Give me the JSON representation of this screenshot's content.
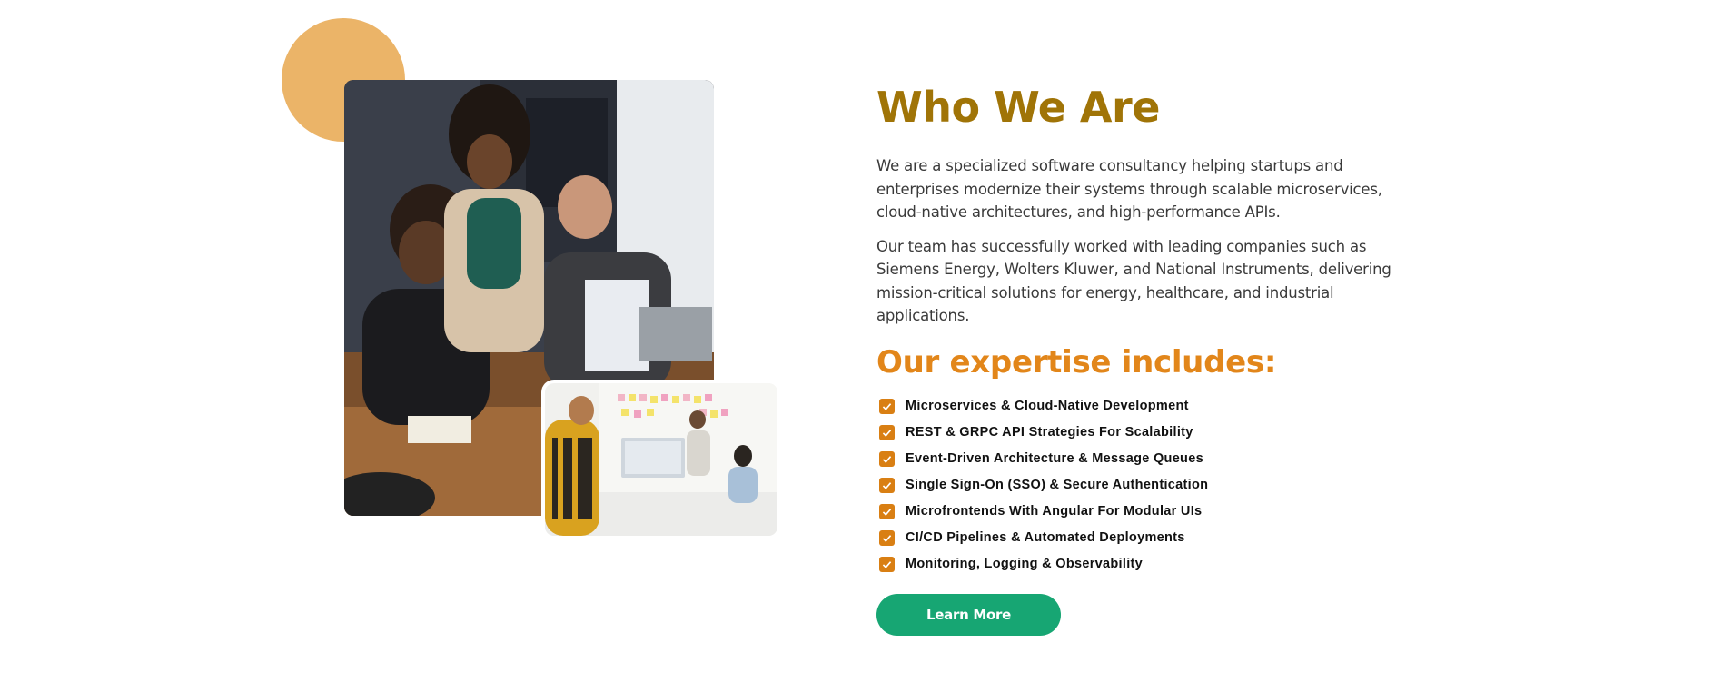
{
  "about": {
    "title": "Who We Are",
    "paragraphs": [
      "We are a specialized software consultancy helping startups and enterprises modernize their systems through scalable microservices, cloud-native architectures, and high-performance APIs.",
      "Our team has successfully worked with leading companies such as Siemens Energy, Wolters Kluwer, and National Instruments, delivering mission-critical solutions for energy, healthcare, and industrial applications."
    ],
    "expertise_title": "Our expertise includes:",
    "expertise_items": [
      "Microservices & Cloud-Native Development",
      "REST & GRPC API Strategies For Scalability",
      "Event-Driven Architecture & Message Queues",
      "Single Sign-On (SSO) & Secure Authentication",
      "Microfrontends With Angular For Modular UIs",
      "CI/CD Pipelines & Automated Deployments",
      "Monitoring, Logging & Observability"
    ],
    "button_label": "Learn More"
  },
  "icons": {
    "list_bullet": "checkbox-checked-icon",
    "decoration": "circle-shape"
  },
  "colors": {
    "heading": "#a07407",
    "subheading": "#e2861a",
    "checkbox": "#d97f13",
    "button": "#17a673",
    "circle": "#ebb468"
  }
}
